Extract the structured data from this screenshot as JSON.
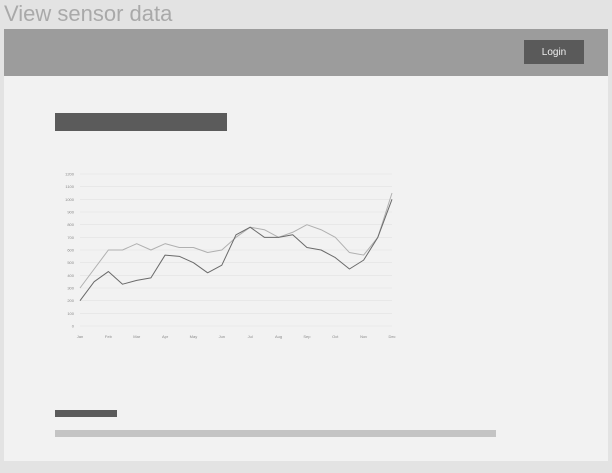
{
  "page": {
    "title": "View sensor data"
  },
  "header": {
    "login_label": "Login"
  },
  "colors": {
    "header_bg": "#9c9c9c",
    "content_bg": "#f2f2f2",
    "placeholder_dark": "#5b5b5b",
    "placeholder_light": "#c4c4c4"
  },
  "chart_data": {
    "type": "line",
    "categories": [
      "Jan",
      "Feb",
      "Mar",
      "Apr",
      "May",
      "Jun",
      "Jul",
      "Aug",
      "Sep",
      "Oct",
      "Nov",
      "Dec"
    ],
    "x": [
      0,
      0.5,
      1,
      1.5,
      2,
      2.5,
      3,
      3.5,
      4,
      4.5,
      5,
      5.5,
      6,
      6.5,
      7,
      7.5,
      8,
      8.5,
      9,
      9.5,
      10,
      10.5,
      11
    ],
    "series": [
      {
        "values": [
          300,
          450,
          600,
          600,
          650,
          600,
          650,
          620,
          620,
          580,
          600,
          700,
          780,
          760,
          700,
          740,
          800,
          760,
          700,
          580,
          560,
          700,
          1050
        ]
      },
      {
        "values": [
          200,
          350,
          430,
          330,
          360,
          380,
          560,
          550,
          500,
          420,
          480,
          720,
          780,
          700,
          700,
          720,
          620,
          600,
          540,
          450,
          520,
          700,
          1000
        ]
      }
    ],
    "yticks": [
      0,
      100,
      200,
      300,
      400,
      500,
      600,
      700,
      800,
      900,
      1000,
      1100,
      1200
    ],
    "ylim": [
      0,
      1200
    ],
    "grid": true,
    "colors": [
      "#b0b0b0",
      "#6a6a6a"
    ]
  }
}
